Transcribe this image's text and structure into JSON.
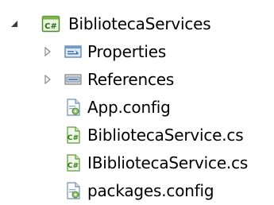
{
  "solution_explorer": {
    "project": {
      "label": "BibliotecaServices",
      "icon": "csharp-project-icon",
      "expanded": true
    },
    "items": [
      {
        "label": "Properties",
        "icon": "properties-icon",
        "expandable": true
      },
      {
        "label": "References",
        "icon": "references-icon",
        "expandable": true
      },
      {
        "label": "App.config",
        "icon": "config-file-icon",
        "expandable": false
      },
      {
        "label": "BibliotecaService.cs",
        "icon": "csharp-file-icon",
        "expandable": false
      },
      {
        "label": "IBibliotecaService.cs",
        "icon": "csharp-file-icon",
        "expandable": false
      },
      {
        "label": "packages.config",
        "icon": "config-file-icon",
        "expandable": false
      }
    ]
  }
}
